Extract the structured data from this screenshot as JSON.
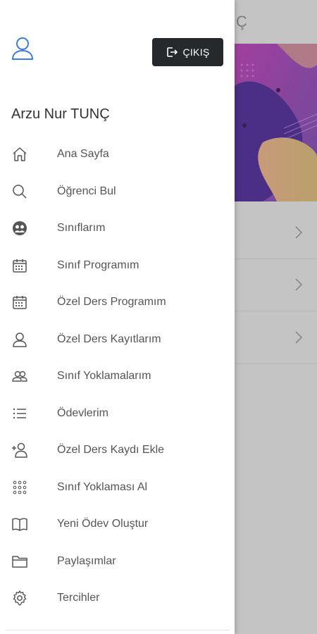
{
  "background": {
    "header_fragment": "Ç",
    "rows": 3
  },
  "drawer": {
    "logout_label": "ÇIKIŞ",
    "user_name": "Arzu Nur TUNÇ",
    "items": [
      {
        "label": "Ana Sayfa",
        "icon": "home-icon"
      },
      {
        "label": "Öğrenci Bul",
        "icon": "search-icon"
      },
      {
        "label": "Sınıflarım",
        "icon": "group-icon"
      },
      {
        "label": "Sınıf Programım",
        "icon": "calendar-icon"
      },
      {
        "label": "Özel Ders Programım",
        "icon": "calendar-icon"
      },
      {
        "label": "Özel Ders Kayıtlarım",
        "icon": "person-icon"
      },
      {
        "label": "Sınıf Yoklamalarım",
        "icon": "people-icon"
      },
      {
        "label": "Ödevlerim",
        "icon": "list-icon"
      },
      {
        "label": "Özel Ders Kaydı Ekle",
        "icon": "person-add-icon"
      },
      {
        "label": "Sınıf Yoklaması Al",
        "icon": "dots-grid-icon"
      },
      {
        "label": "Yeni Ödev Oluştur",
        "icon": "book-icon"
      },
      {
        "label": "Paylaşımlar",
        "icon": "folder-icon"
      },
      {
        "label": "Tercihler",
        "icon": "gear-icon"
      }
    ]
  },
  "colors": {
    "accent": "#3d7be0",
    "logout_bg": "#26292b",
    "icon": "#555555"
  }
}
